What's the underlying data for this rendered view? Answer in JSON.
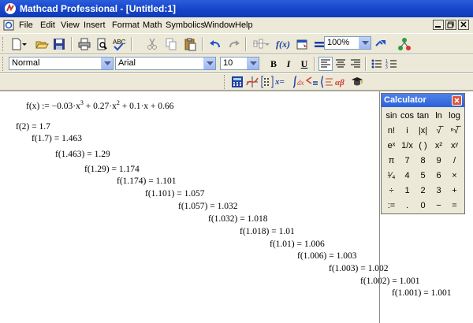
{
  "window": {
    "title": "Mathcad Professional - [Untitled:1]",
    "title_color": "#1545C9"
  },
  "menubar": {
    "items": [
      {
        "label": "File"
      },
      {
        "label": "Edit"
      },
      {
        "label": "View"
      },
      {
        "label": "Insert"
      },
      {
        "label": "Format"
      },
      {
        "label": "Math"
      },
      {
        "label": "Symbolics"
      },
      {
        "label": "Window"
      },
      {
        "label": "Help"
      }
    ]
  },
  "standard_toolbar": {
    "zoom_value": "100%",
    "icons": [
      "new-icon",
      "open-icon",
      "save-icon",
      "print-icon",
      "print-preview-icon",
      "spell-check-icon",
      "cut-icon",
      "copy-icon",
      "paste-icon",
      "undo-icon",
      "redo-icon",
      "align-icon",
      "insert-function-icon",
      "insert-unit-icon",
      "calculate-icon",
      "insert-hyperlink-icon",
      "component-wizard-icon"
    ]
  },
  "formatting_toolbar": {
    "style_value": "Normal",
    "font_value": "Arial",
    "size_value": "10",
    "bold_label": "B",
    "italic_label": "I",
    "underline_label": "U"
  },
  "math_toolbar": {
    "icons": [
      "calculator-palette-icon",
      "graph-palette-icon",
      "matrix-palette-icon",
      "evaluation-palette-icon",
      "calculus-palette-icon",
      "boolean-palette-icon",
      "programming-palette-icon",
      "greek-palette-icon",
      "symbolic-palette-icon"
    ],
    "evaluation_label": "x="
  },
  "worksheet": {
    "definition": {
      "lhs": "f(x) := ",
      "body": "−0.03·x",
      "exp1": "3",
      "mid": " + 0.27·x",
      "exp2": "2",
      "tail": " + 0.1·x + 0.66"
    },
    "evaluations": [
      "f(2) = 1.7",
      "f(1.7) = 1.463",
      "f(1.463) = 1.29",
      "f(1.29) = 1.174",
      "f(1.174) = 1.101",
      "f(1.101) = 1.057",
      "f(1.057) = 1.032",
      "f(1.032) = 1.018",
      "f(1.018) = 1.01",
      "f(1.01) = 1.006",
      "f(1.006) = 1.003",
      "f(1.003) = 1.002",
      "f(1.002) = 1.001",
      "f(1.001) = 1.001"
    ]
  },
  "calculator": {
    "title": "Calculator",
    "keys": [
      [
        "sin",
        "cos",
        "tan",
        "ln",
        "log"
      ],
      [
        "n!",
        "i",
        "|x|",
        "√̅",
        "ⁿ√̅"
      ],
      [
        "eˣ",
        "1/x",
        "( )",
        "x²",
        "xʸ"
      ],
      [
        "π",
        "7",
        "8",
        "9",
        "/"
      ],
      [
        "¹⁄₄",
        "4",
        "5",
        "6",
        "×"
      ],
      [
        "÷",
        "1",
        "2",
        "3",
        "+"
      ],
      [
        ":=",
        ".",
        "0",
        "−",
        "="
      ]
    ]
  }
}
